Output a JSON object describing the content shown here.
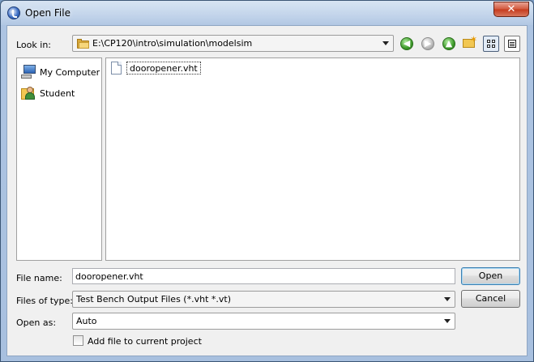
{
  "window": {
    "title": "Open File",
    "close_glyph": "✕"
  },
  "look_in": {
    "label": "Look in:",
    "path": "E:\\CP120\\intro\\simulation\\modelsim"
  },
  "toolbar": {
    "icons": [
      "back-icon",
      "forward-icon",
      "up-folder-icon",
      "new-folder-icon",
      "list-view-icon",
      "detail-view-icon"
    ],
    "back_glyph": "◀",
    "forward_glyph": "▶",
    "up_glyph": "▲",
    "new_folder_glyph": "✶"
  },
  "sidebar": {
    "items": [
      {
        "label": "My Computer",
        "icon": "computer-icon"
      },
      {
        "label": "Student",
        "icon": "user-folder-icon"
      }
    ]
  },
  "files": [
    {
      "name": "dooropener.vht",
      "icon": "file-icon"
    }
  ],
  "form": {
    "file_name_label": "File name:",
    "file_name_value": "dooropener.vht",
    "files_of_type_label": "Files of type:",
    "files_of_type_value": "Test Bench Output Files (*.vht *.vt)",
    "open_as_label": "Open as:",
    "open_as_value": "Auto",
    "add_to_project_label": "Add file to current project",
    "add_to_project_checked": false
  },
  "buttons": {
    "open": "Open",
    "cancel": "Cancel"
  }
}
